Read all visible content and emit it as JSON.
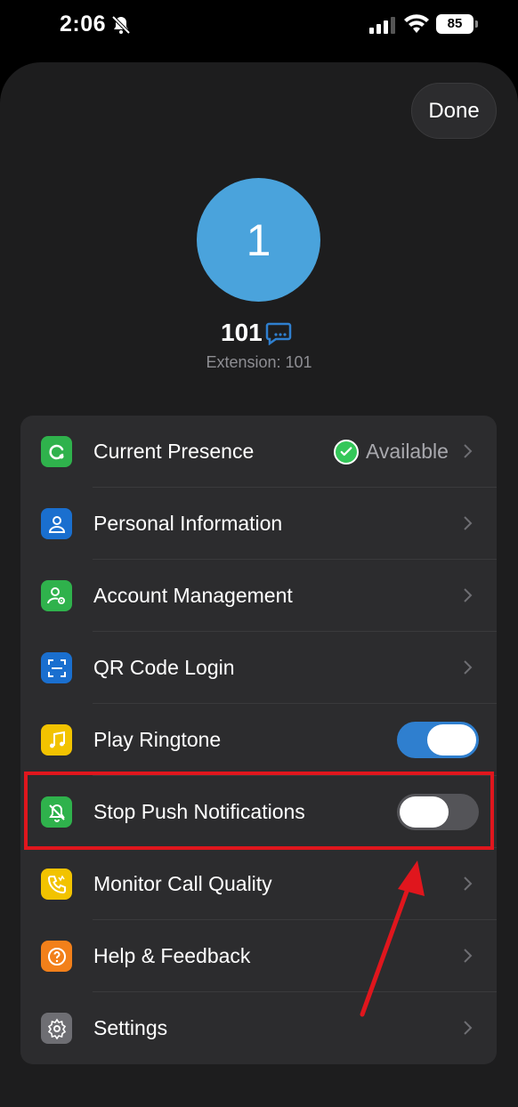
{
  "status_bar": {
    "time": "2:06",
    "battery": "85",
    "icons": [
      "bell-off-icon",
      "cellular-signal-icon",
      "wifi-icon",
      "battery-icon"
    ]
  },
  "header": {
    "done_label": "Done"
  },
  "profile": {
    "avatar_text": "1",
    "avatar_color": "#4aa3dc",
    "name": "101",
    "extension": "Extension: 101"
  },
  "menu": {
    "items": [
      {
        "label": "Current Presence",
        "icon": "presence-icon",
        "icon_color": "#2fb24c",
        "value": "Available",
        "control": "chevron"
      },
      {
        "label": "Personal Information",
        "icon": "person-icon",
        "icon_color": "#1a6fcf",
        "control": "chevron"
      },
      {
        "label": "Account Management",
        "icon": "account-settings-icon",
        "icon_color": "#2fb24c",
        "control": "chevron"
      },
      {
        "label": "QR Code Login",
        "icon": "qr-scan-icon",
        "icon_color": "#1a6fcf",
        "control": "chevron"
      },
      {
        "label": "Play Ringtone",
        "icon": "music-note-icon",
        "icon_color": "#f2c300",
        "control": "toggle",
        "enabled": true
      },
      {
        "label": "Stop Push Notifications",
        "icon": "bell-off-icon",
        "icon_color": "#2fb24c",
        "control": "toggle",
        "enabled": false
      },
      {
        "label": "Monitor Call Quality",
        "icon": "phone-quality-icon",
        "icon_color": "#f2c300",
        "control": "chevron"
      },
      {
        "label": "Help & Feedback",
        "icon": "question-icon",
        "icon_color": "#f2801a",
        "control": "chevron"
      },
      {
        "label": "Settings",
        "icon": "gear-icon",
        "icon_color": "#6e6e73",
        "control": "chevron"
      }
    ]
  },
  "colors": {
    "accent": "#2f7fcf",
    "highlight": "#e0161d",
    "background": "#1d1d1e",
    "card": "#2c2c2e"
  }
}
